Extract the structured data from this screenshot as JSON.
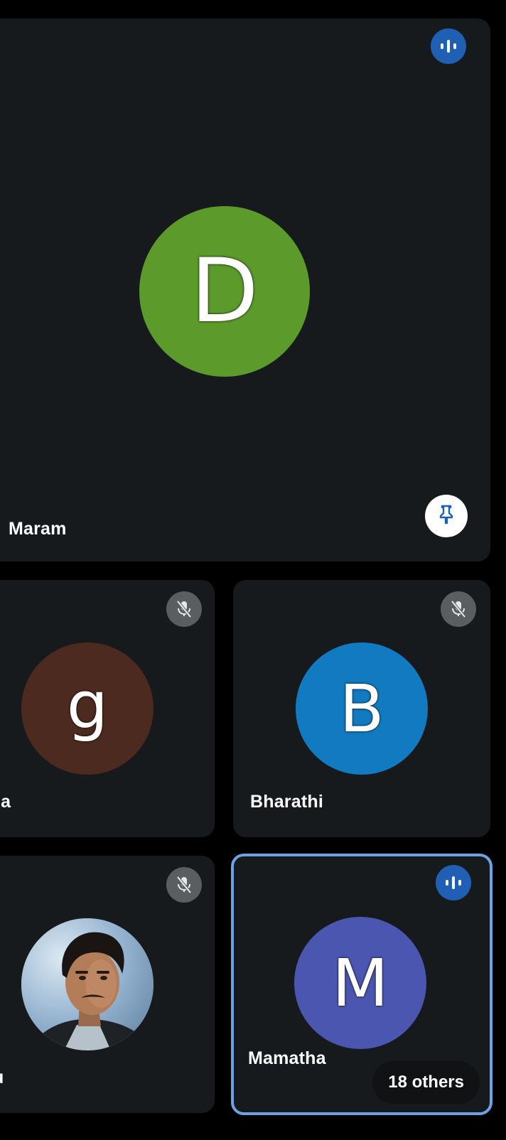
{
  "tiles": {
    "main": {
      "initial": "D",
      "name": "Maram",
      "avatar_color": "#5c9a2b",
      "status": "speaking-icon"
    },
    "g": {
      "initial": "g",
      "name": "la",
      "avatar_color": "#4d2a1f",
      "status": "mic-off-icon"
    },
    "b": {
      "initial": "B",
      "name": "Bharathi",
      "avatar_color": "#127ac0",
      "status": "mic-off-icon"
    },
    "u": {
      "name": "u",
      "status": "mic-off-icon"
    },
    "m": {
      "initial": "M",
      "name": "Mamatha",
      "avatar_color": "#4b56b0",
      "status": "speaking-icon",
      "others_label": "18 others"
    }
  },
  "colors": {
    "tile_background": "#171a1c",
    "active_outline": "#6ea1e6",
    "speaking_badge": "#1f5fb4",
    "muted_badge": "#5b5e61"
  }
}
